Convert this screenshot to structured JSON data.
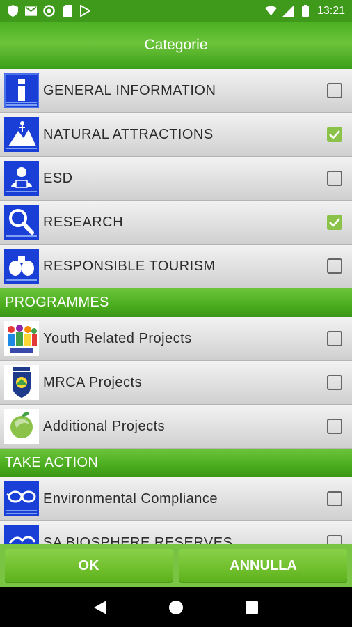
{
  "status_bar": {
    "time": "13:21",
    "left_icons": [
      "shield-icon",
      "gmail-icon",
      "circle-icon",
      "sd-card-icon",
      "play-store-icon"
    ],
    "right_icons": [
      "wifi-icon",
      "signal-icon",
      "battery-icon"
    ]
  },
  "title": "Categorie",
  "sections": [
    {
      "header": "",
      "items": [
        {
          "label": "GENERAL INFORMATION",
          "icon": "info-icon",
          "checked": false
        },
        {
          "label": "NATURAL ATTRACTIONS",
          "icon": "mountain-icon",
          "checked": true
        },
        {
          "label": "ESD",
          "icon": "reader-icon",
          "checked": false
        },
        {
          "label": "RESEARCH",
          "icon": "magnifier-icon",
          "checked": true
        },
        {
          "label": "RESPONSIBLE TOURISM",
          "icon": "binoculars-icon",
          "checked": false
        }
      ]
    },
    {
      "header": "PROGRAMMES",
      "items": [
        {
          "label": "Youth Related Projects",
          "icon": "youth-logo-icon",
          "checked": false
        },
        {
          "label": "MRCA Projects",
          "icon": "mrca-logo-icon",
          "checked": false
        },
        {
          "label": "Additional Projects",
          "icon": "earth-leaf-icon",
          "checked": false
        }
      ]
    },
    {
      "header": "TAKE ACTION",
      "items": [
        {
          "label": "Environmental Compliance",
          "icon": "glasses-icon",
          "checked": false
        },
        {
          "label": "SA BIOSPHERE RESERVES",
          "icon": "biosphere-icon",
          "checked": false
        }
      ]
    }
  ],
  "buttons": {
    "ok": "OK",
    "cancel": "ANNULLA"
  },
  "colors": {
    "accent_green": "#8bc34a",
    "header_green": "#4aac1e",
    "icon_blue": "#1a3fd6"
  }
}
